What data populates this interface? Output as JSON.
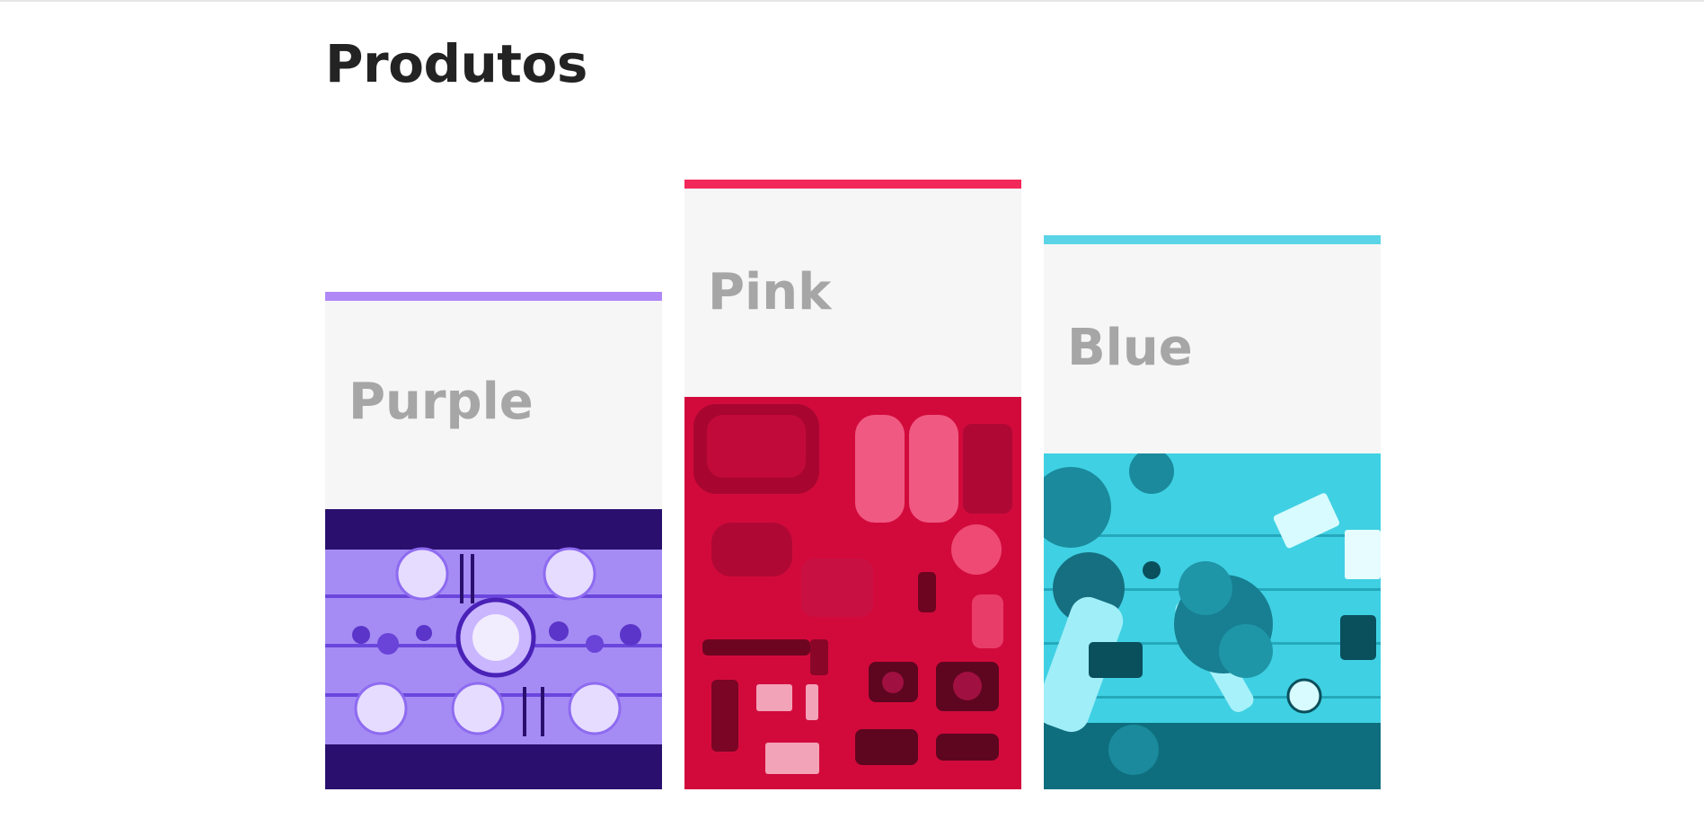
{
  "page": {
    "title": "Produtos"
  },
  "cards": [
    {
      "label": "Purple",
      "accent": "#b088f5",
      "tint": "#7d4df2",
      "image": "dining-table-photo"
    },
    {
      "label": "Pink",
      "accent": "#f3285a",
      "tint": "#e40c43",
      "image": "travel-gear-photo"
    },
    {
      "label": "Blue",
      "accent": "#5ad4e6",
      "tint": "#2ad2e6",
      "image": "workspace-flowers-photo"
    }
  ]
}
